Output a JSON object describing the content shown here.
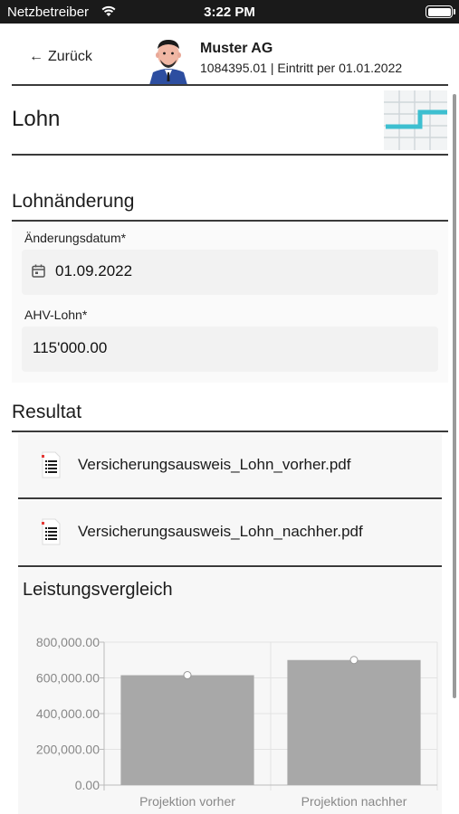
{
  "status_bar": {
    "carrier": "Netzbetreiber",
    "time": "3:22 PM"
  },
  "header": {
    "back_label": "Zurück",
    "company": "Muster AG",
    "subtitle": "1084395.01 | Eintritt per 01.01.2022"
  },
  "page": {
    "title": "Lohn"
  },
  "lohnaenderung": {
    "title": "Lohnänderung",
    "date_label": "Änderungsdatum*",
    "date_value": "01.09.2022",
    "salary_label": "AHV-Lohn*",
    "salary_value": "115'000.00"
  },
  "resultat": {
    "title": "Resultat",
    "files": [
      {
        "name": "Versicherungsausweis_Lohn_vorher.pdf"
      },
      {
        "name": "Versicherungsausweis_Lohn_nachher.pdf"
      }
    ]
  },
  "chart_data": {
    "type": "bar",
    "title": "Leistungsvergleich",
    "categories": [
      "Projektion vorher",
      "Projektion nachher"
    ],
    "values": [
      615000,
      700000
    ],
    "ylim": [
      0,
      800000
    ],
    "yticks": [
      0,
      200000,
      400000,
      600000,
      800000
    ],
    "ytick_labels": [
      "0.00",
      "200,000.00",
      "400,000.00",
      "600,000.00",
      "800,000.00"
    ],
    "bar_color": "#a8a8a8",
    "grid": true
  },
  "colors": {
    "accent": "#3dbfd0",
    "divider": "#3a3a3a"
  }
}
